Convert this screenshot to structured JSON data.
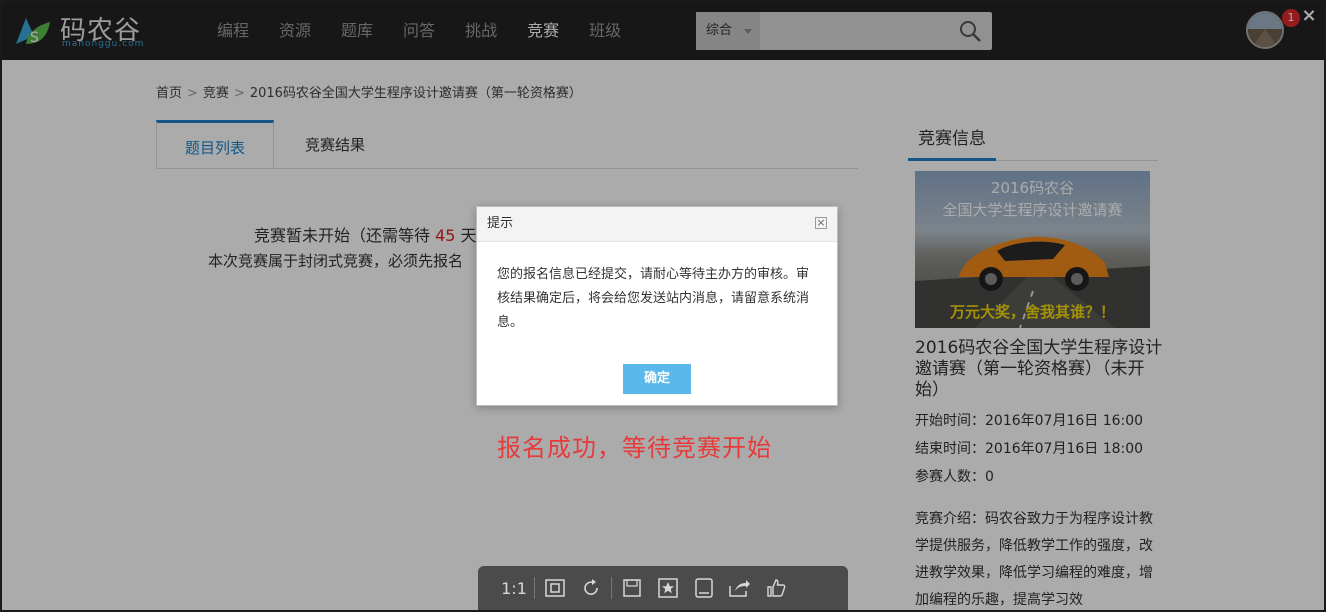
{
  "header": {
    "logo_text": "码农谷",
    "logo_sub": "manonggu.com",
    "nav": [
      "编程",
      "资源",
      "题库",
      "问答",
      "挑战",
      "竞赛",
      "班级"
    ],
    "active_nav": "竞赛",
    "search": {
      "category": "综合",
      "placeholder": ""
    },
    "notification_count": "1",
    "close_glyph": "×"
  },
  "breadcrumb": [
    "首页",
    "竞赛",
    "2016码农谷全国大学生程序设计邀请赛（第一轮资格赛）"
  ],
  "breadcrumb_sep": ">",
  "tabs": [
    "题目列表",
    "竞赛结果"
  ],
  "main_message": {
    "line1_prefix": "竞赛暂未开始（还需等待 ",
    "line1_days": "45",
    "line1_suffix": " 天",
    "line2": "本次竞赛属于封闭式竞赛，必须先报名"
  },
  "sidebar": {
    "title": "竞赛信息",
    "poster": {
      "line1": "2016码农谷",
      "line2": "全国大学生程序设计邀请赛",
      "slogan": "万元大奖，舍我其谁？！"
    },
    "contest_name": "2016码农谷全国大学生程序设计邀请赛（第一轮资格赛）（未开始）",
    "start_time": "开始时间：2016年07月16日 16:00",
    "end_time": "结束时间：2016年07月16日 18:00",
    "participants": "参赛人数：0",
    "description": "竞赛介绍：码农谷致力于为程序设计教学提供服务，降低教学工作的强度，改进教学效果，降低学习编程的难度，增加编程的乐趣，提高学习效"
  },
  "dialog": {
    "title": "提示",
    "close_glyph": "×",
    "body": "您的报名信息已经提交，请耐心等待主办方的审核。审核结果确定后，将会给您发送站内消息，请留意系统消息。",
    "ok_label": "确定"
  },
  "caption": "报名成功，等待竞赛开始",
  "toolbar": {
    "actual_size_label": "1:1"
  },
  "colors": {
    "header_bg": "#232323",
    "accent_blue": "#1e80c6",
    "button_blue": "#5ab8ea",
    "caption_red": "#e83a3a",
    "badge_red": "#e2292a"
  }
}
